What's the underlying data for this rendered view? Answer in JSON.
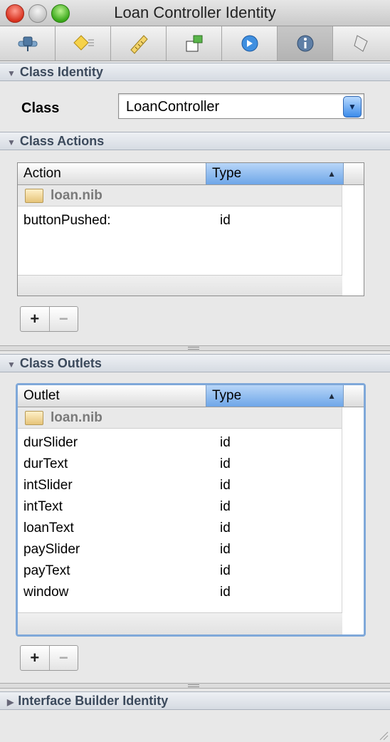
{
  "window": {
    "title": "Loan Controller Identity"
  },
  "toolbar": {
    "tabs": [
      {
        "icon": "attributes-icon"
      },
      {
        "icon": "effects-icon"
      },
      {
        "icon": "size-ruler-icon"
      },
      {
        "icon": "connections-icon"
      },
      {
        "icon": "bindings-icon"
      },
      {
        "icon": "identity-info-icon"
      },
      {
        "icon": "applescript-icon"
      }
    ],
    "active_index": 5
  },
  "class_identity": {
    "header": "Class Identity",
    "label": "Class",
    "value": "LoanController"
  },
  "class_actions": {
    "header": "Class Actions",
    "columns": [
      "Action",
      "Type"
    ],
    "group": "loan.nib",
    "rows": [
      {
        "name": "buttonPushed:",
        "type": "id"
      }
    ]
  },
  "class_outlets": {
    "header": "Class Outlets",
    "columns": [
      "Outlet",
      "Type"
    ],
    "group": "loan.nib",
    "rows": [
      {
        "name": "durSlider",
        "type": "id"
      },
      {
        "name": "durText",
        "type": "id"
      },
      {
        "name": "intSlider",
        "type": "id"
      },
      {
        "name": "intText",
        "type": "id"
      },
      {
        "name": "loanText",
        "type": "id"
      },
      {
        "name": "paySlider",
        "type": "id"
      },
      {
        "name": "payText",
        "type": "id"
      },
      {
        "name": "window",
        "type": "id"
      }
    ]
  },
  "buttons": {
    "plus": "+",
    "minus": "−"
  },
  "interface_builder_identity": {
    "header": "Interface Builder Identity"
  },
  "colors": {
    "accent": "#6ea6e8",
    "focus_ring": "#7fa8d9"
  }
}
